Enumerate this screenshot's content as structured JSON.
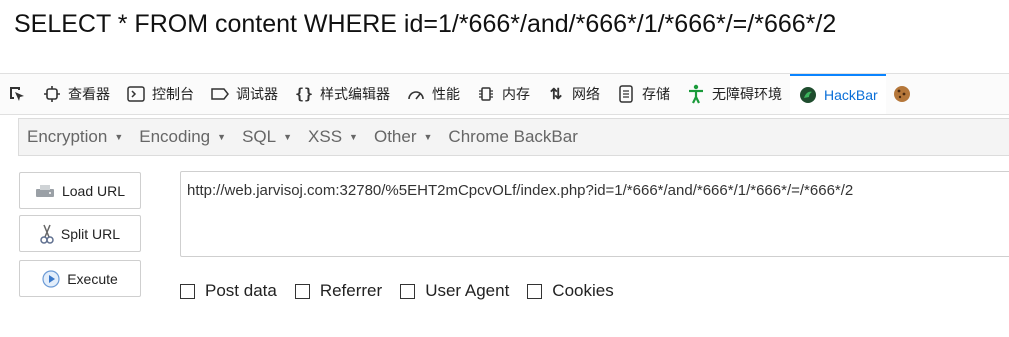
{
  "page": {
    "query_text": "SELECT * FROM content WHERE id=1/*666*/and/*666*/1/*666*/=/*666*/2"
  },
  "devtools": {
    "tabs": [
      {
        "label": "查看器",
        "icon": "inspector-icon"
      },
      {
        "label": "控制台",
        "icon": "console-icon"
      },
      {
        "label": "调试器",
        "icon": "debugger-icon"
      },
      {
        "label": "样式编辑器",
        "icon": "style-editor-icon"
      },
      {
        "label": "性能",
        "icon": "performance-icon"
      },
      {
        "label": "内存",
        "icon": "memory-icon"
      },
      {
        "label": "网络",
        "icon": "network-icon"
      },
      {
        "label": "存储",
        "icon": "storage-icon"
      },
      {
        "label": "无障碍环境",
        "icon": "accessibility-icon"
      },
      {
        "label": "HackBar",
        "icon": "hackbar-icon"
      }
    ],
    "active_tab": "HackBar",
    "accent_color": "#0a84ff"
  },
  "hackbar": {
    "menu": [
      {
        "label": "Encryption"
      },
      {
        "label": "Encoding"
      },
      {
        "label": "SQL"
      },
      {
        "label": "XSS"
      },
      {
        "label": "Other"
      },
      {
        "label": "Chrome BackBar"
      }
    ],
    "buttons": {
      "load_url": "Load URL",
      "split_url": "Split URL",
      "execute": "Execute"
    },
    "url_value": "http://web.jarvisoj.com:32780/%5EHT2mCpcvOLf/index.php?id=1/*666*/and/*666*/1/*666*/=/*666*/2",
    "checkboxes": [
      {
        "label": "Post data",
        "checked": false
      },
      {
        "label": "Referrer",
        "checked": false
      },
      {
        "label": "User Agent",
        "checked": false
      },
      {
        "label": "Cookies",
        "checked": false
      }
    ]
  }
}
